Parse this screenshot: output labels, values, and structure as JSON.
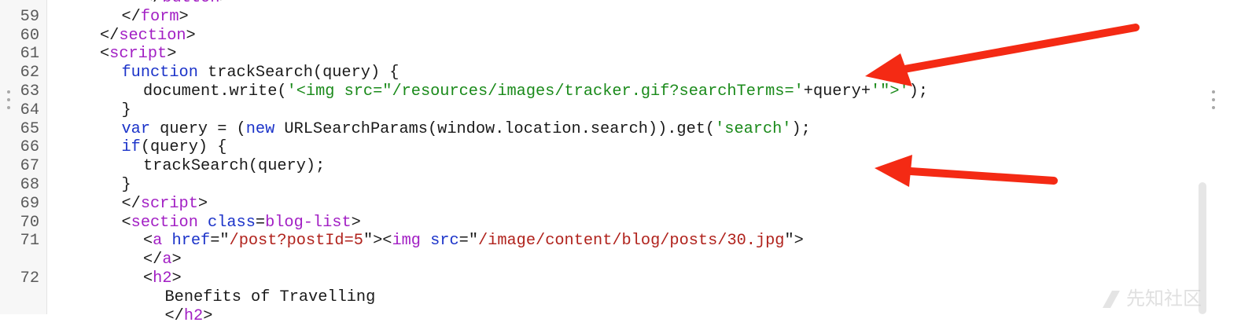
{
  "lines": [
    {
      "n": "",
      "indent": 4,
      "tokens": [
        {
          "t": "</"
        },
        {
          "t": "button",
          "c": "tag"
        },
        {
          "t": ">"
        }
      ]
    },
    {
      "n": "59",
      "indent": 3,
      "tokens": [
        {
          "t": "</"
        },
        {
          "t": "form",
          "c": "tag"
        },
        {
          "t": ">"
        }
      ]
    },
    {
      "n": "60",
      "indent": 2,
      "tokens": [
        {
          "t": "</"
        },
        {
          "t": "section",
          "c": "tag"
        },
        {
          "t": ">"
        }
      ]
    },
    {
      "n": "61",
      "indent": 2,
      "tokens": [
        {
          "t": "<"
        },
        {
          "t": "script",
          "c": "tag"
        },
        {
          "t": ">"
        }
      ]
    },
    {
      "n": "62",
      "indent": 3,
      "tokens": [
        {
          "t": "function",
          "c": "kw"
        },
        {
          "t": " trackSearch(query) {"
        }
      ]
    },
    {
      "n": "63",
      "indent": 4,
      "tokens": [
        {
          "t": "document.write("
        },
        {
          "t": "'<img src=\"/resources/images/tracker.gif?searchTerms='",
          "c": "str"
        },
        {
          "t": "+query+"
        },
        {
          "t": "'\">'",
          "c": "str"
        },
        {
          "t": ");"
        }
      ]
    },
    {
      "n": "64",
      "indent": 3,
      "tokens": [
        {
          "t": "}"
        }
      ]
    },
    {
      "n": "65",
      "indent": 3,
      "tokens": [
        {
          "t": "var",
          "c": "kw"
        },
        {
          "t": " query = ("
        },
        {
          "t": "new",
          "c": "kw"
        },
        {
          "t": " URLSearchParams(window.location.search)).get("
        },
        {
          "t": "'search'",
          "c": "str"
        },
        {
          "t": ");"
        }
      ]
    },
    {
      "n": "66",
      "indent": 3,
      "tokens": [
        {
          "t": "if",
          "c": "kw"
        },
        {
          "t": "(query) {"
        }
      ]
    },
    {
      "n": "67",
      "indent": 4,
      "tokens": [
        {
          "t": "trackSearch(query);"
        }
      ]
    },
    {
      "n": "68",
      "indent": 3,
      "tokens": [
        {
          "t": "}"
        }
      ]
    },
    {
      "n": "69",
      "indent": 3,
      "tokens": [
        {
          "t": "</"
        },
        {
          "t": "script",
          "c": "tag"
        },
        {
          "t": ">"
        }
      ]
    },
    {
      "n": "70",
      "indent": 3,
      "tokens": [
        {
          "t": "<"
        },
        {
          "t": "section",
          "c": "tag"
        },
        {
          "t": " "
        },
        {
          "t": "class",
          "c": "attr"
        },
        {
          "t": "="
        },
        {
          "t": "blog-list",
          "c": "tag"
        },
        {
          "t": ">"
        }
      ]
    },
    {
      "n": "71",
      "indent": 4,
      "tokens": [
        {
          "t": "<"
        },
        {
          "t": "a",
          "c": "tag"
        },
        {
          "t": " "
        },
        {
          "t": "href",
          "c": "attr"
        },
        {
          "t": "=\""
        },
        {
          "t": "/post?postId=5",
          "c": "attrval"
        },
        {
          "t": "\"><"
        },
        {
          "t": "img",
          "c": "tag"
        },
        {
          "t": " "
        },
        {
          "t": "src",
          "c": "attr"
        },
        {
          "t": "=\""
        },
        {
          "t": "/image/content/blog/posts/30.jpg",
          "c": "attrval"
        },
        {
          "t": "\">"
        }
      ]
    },
    {
      "n": "",
      "indent": 4,
      "tokens": [
        {
          "t": "</"
        },
        {
          "t": "a",
          "c": "tag"
        },
        {
          "t": ">"
        }
      ]
    },
    {
      "n": "72",
      "indent": 4,
      "tokens": [
        {
          "t": "<"
        },
        {
          "t": "h2",
          "c": "tag"
        },
        {
          "t": ">"
        }
      ]
    },
    {
      "n": "",
      "indent": 5,
      "tokens": [
        {
          "t": "Benefits of Travelling"
        }
      ]
    },
    {
      "n": "",
      "indent": 5,
      "tokens": [
        {
          "t": "</"
        },
        {
          "t": "h2",
          "c": "tag"
        },
        {
          "t": ">"
        }
      ]
    }
  ],
  "colors": {
    "tag": "#a21fc4",
    "keyword": "#1b33c9",
    "attribute": "#1b33c9",
    "string": "#1a8a1a",
    "attribute_value": "#b0221c",
    "annotation_arrow": "#f42a14"
  },
  "icons": {
    "left_handle": "drag-handle-icon",
    "right_handle": "drag-handle-icon"
  },
  "watermark": {
    "text": "先知社区"
  }
}
